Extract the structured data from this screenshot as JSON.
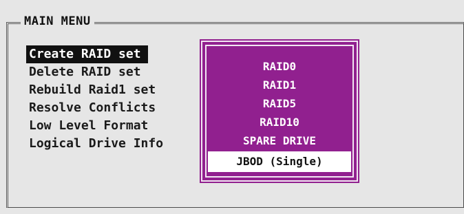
{
  "window": {
    "title": "MAIN MENU"
  },
  "main_menu": {
    "items": [
      {
        "label": "Create RAID set",
        "selected": true
      },
      {
        "label": "Delete RAID set",
        "selected": false
      },
      {
        "label": "Rebuild Raid1 set",
        "selected": false
      },
      {
        "label": "Resolve Conflicts",
        "selected": false
      },
      {
        "label": "Low Level Format",
        "selected": false
      },
      {
        "label": "Logical Drive Info",
        "selected": false
      }
    ]
  },
  "raid_type_popup": {
    "options": [
      {
        "label": "RAID0",
        "highlighted": false
      },
      {
        "label": "RAID1",
        "highlighted": false
      },
      {
        "label": "RAID5",
        "highlighted": false
      },
      {
        "label": "RAID10",
        "highlighted": false
      },
      {
        "label": "SPARE DRIVE",
        "highlighted": false
      },
      {
        "label": "JBOD (Single)",
        "highlighted": true
      }
    ]
  },
  "colors": {
    "background": "#e6e6e6",
    "popup": "#91208f",
    "selection": "#111111",
    "highlight": "#ffffff"
  }
}
